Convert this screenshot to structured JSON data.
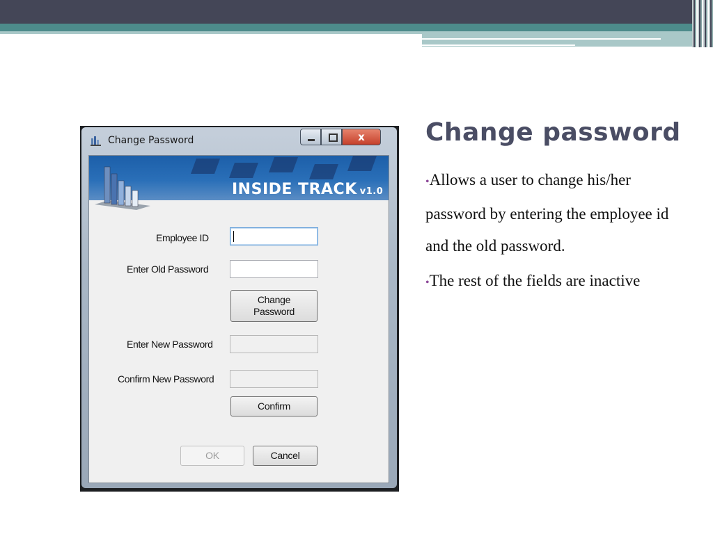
{
  "slide": {
    "title": "Change password",
    "bullets": [
      {
        "dot": "•",
        "text": "Allows a user  to change his/her password by entering the employee id and the old password."
      },
      {
        "dot": "•",
        "text": "The rest of the fields are inactive"
      }
    ]
  },
  "dialog": {
    "title": "Change Password",
    "close_glyph": "x",
    "banner": {
      "name": "INSIDE TRACK",
      "version": "v1.0"
    },
    "fields": {
      "employee_id_label": "Employee ID",
      "old_password_label": "Enter Old Password",
      "new_password_label": "Enter New Password",
      "confirm_password_label": "Confirm New Password"
    },
    "buttons": {
      "change_line1": "Change",
      "change_line2": "Password",
      "confirm": "Confirm",
      "ok": "OK",
      "cancel": "Cancel"
    }
  },
  "colors": {
    "banner_blue": "#1c5fa9",
    "title_slate": "#4a4d64",
    "bullet_purple": "#8e4a9a",
    "close_red": "#c5402a"
  },
  "icons": [
    "window-app-icon",
    "minimize-icon",
    "maximize-icon",
    "close-icon",
    "bar-chart-logo-icon"
  ]
}
